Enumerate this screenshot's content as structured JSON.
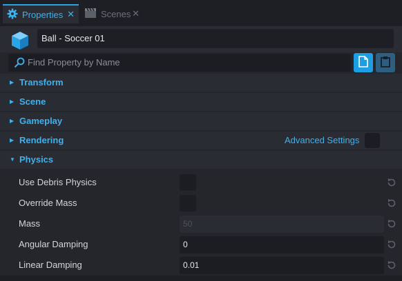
{
  "tabs": [
    {
      "label": "Properties",
      "active": true,
      "icon": "gear-icon"
    },
    {
      "label": "Scenes",
      "active": false,
      "icon": "clapperboard-icon"
    }
  ],
  "object": {
    "name": "Ball - Soccer 01",
    "icon": "cube-icon"
  },
  "search": {
    "placeholder": "Find Property by Name"
  },
  "sections": {
    "transform": "Transform",
    "scene": "Scene",
    "gameplay": "Gameplay",
    "rendering": "Rendering",
    "physics": "Physics"
  },
  "advanced_settings": {
    "label": "Advanced Settings",
    "checked": false
  },
  "physics_props": {
    "use_debris": {
      "label": "Use Debris Physics",
      "checked": false
    },
    "override_mass": {
      "label": "Override Mass",
      "checked": false
    },
    "mass": {
      "label": "Mass",
      "value": "50",
      "disabled": true
    },
    "angular_damping": {
      "label": "Angular Damping",
      "value": "0"
    },
    "linear_damping": {
      "label": "Linear Damping",
      "value": "0.01"
    }
  },
  "colors": {
    "accent": "#3db2f0",
    "background": "#24262c"
  }
}
